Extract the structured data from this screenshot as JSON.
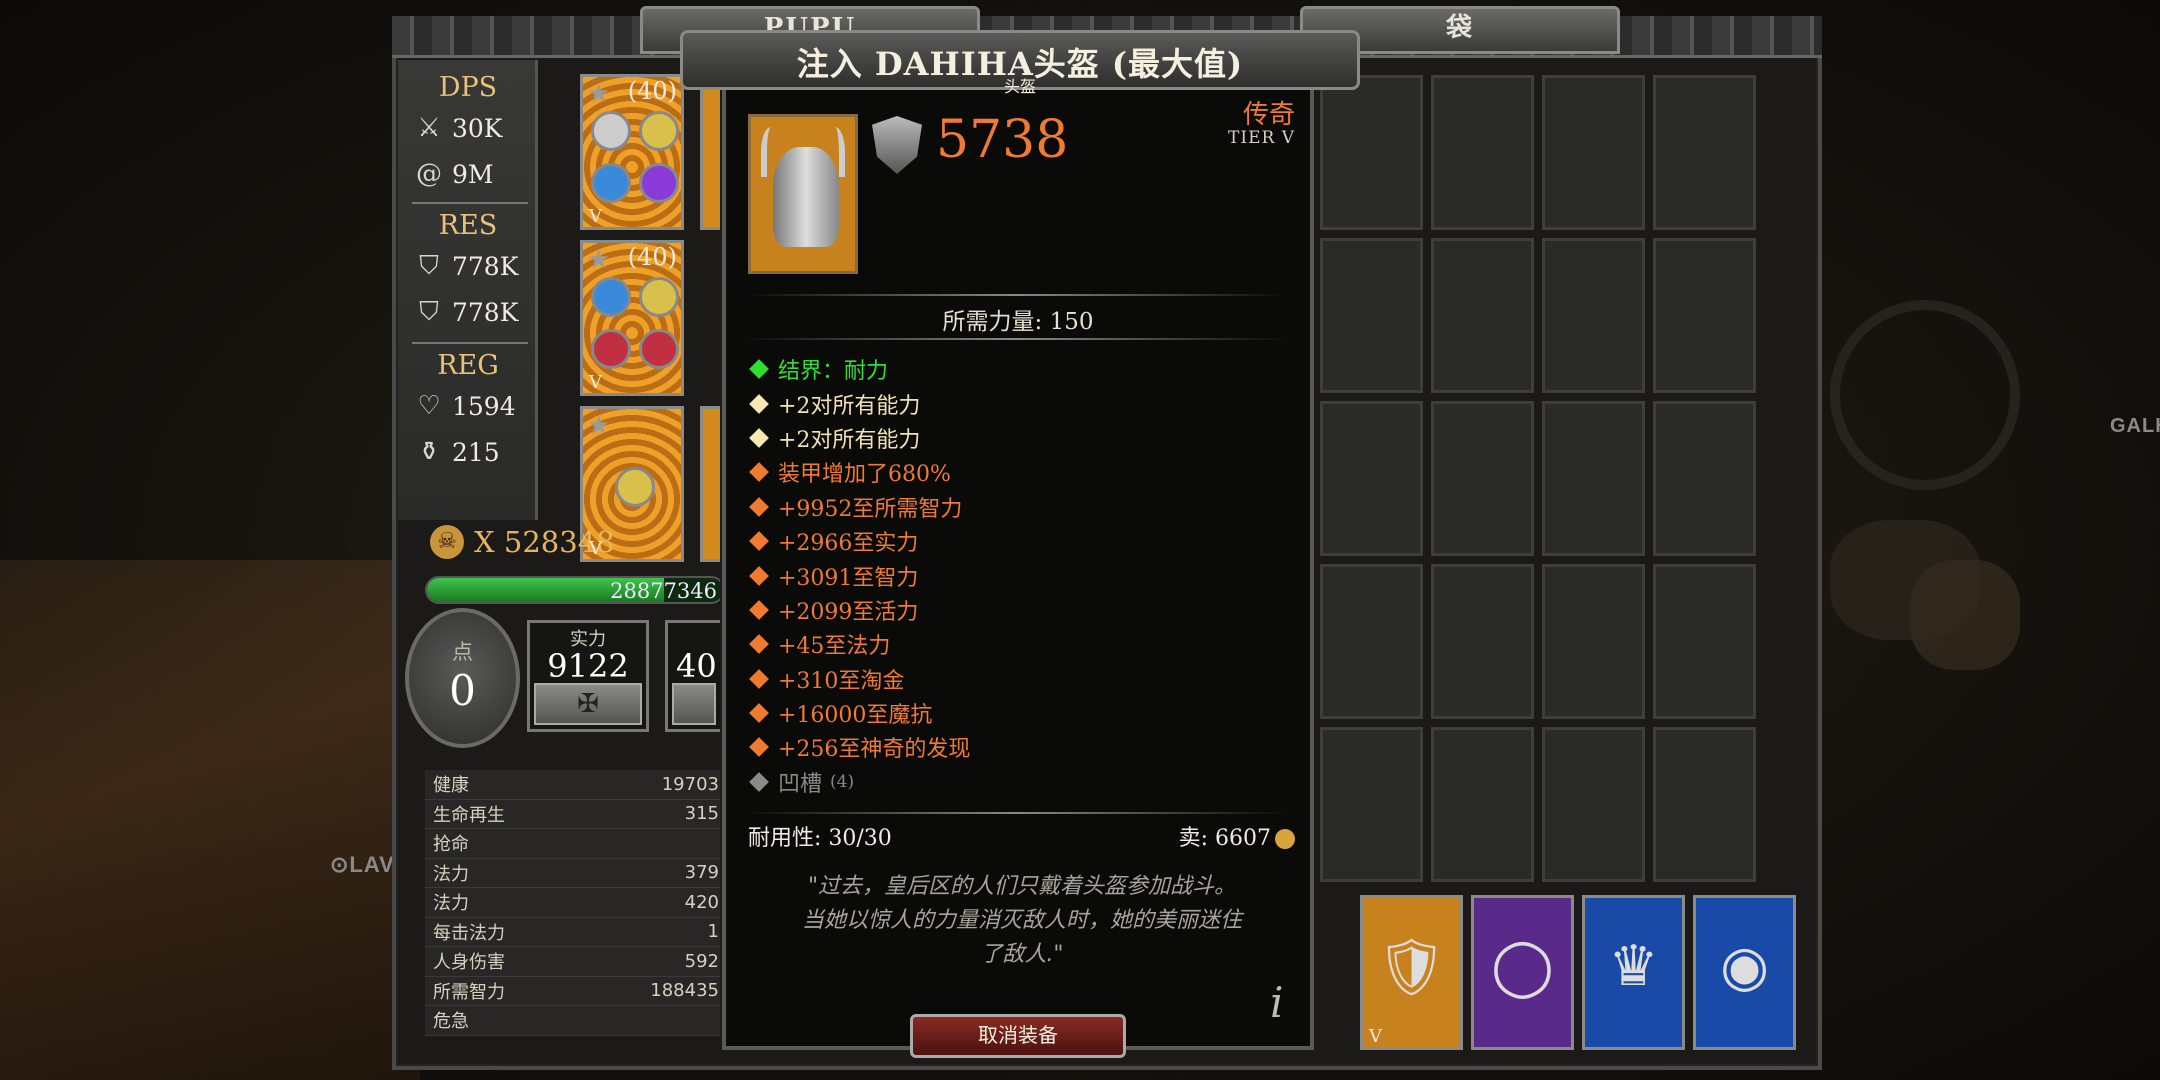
{
  "colors": {
    "legendary": "#f07a30",
    "set_bonus": "#2ee02e",
    "stat_base": "#f7e7b0",
    "socket": "#8a8a86",
    "xp_bar": "#3ec24a"
  },
  "background": {
    "label_galh": "GALH",
    "label_lav": "⊙LAV"
  },
  "tabs": {
    "left": "PUPU",
    "right": "袋"
  },
  "stats_panel": {
    "dps_title": "DPS",
    "dps": [
      {
        "icon": "crossed-swords-icon",
        "value": "30K"
      },
      {
        "icon": "spiral-magic-icon",
        "value": "9M"
      }
    ],
    "res_title": "RES",
    "res": [
      {
        "icon": "shield-sword-icon",
        "value": "778K"
      },
      {
        "icon": "shield-magic-icon",
        "value": "778K"
      }
    ],
    "reg_title": "REG",
    "reg": [
      {
        "icon": "heart-icon",
        "value": "1594"
      },
      {
        "icon": "mana-flask-icon",
        "value": "215"
      }
    ]
  },
  "gem_slots": [
    {
      "count": "(40)",
      "tier": "V"
    },
    {
      "count": "(40)",
      "tier": "V"
    },
    {
      "count": "",
      "tier": "V"
    }
  ],
  "skull": {
    "value": "X 528348"
  },
  "xp": {
    "text": "28877346",
    "fraction": 0.8
  },
  "points": {
    "label": "点",
    "value": "0"
  },
  "attributes": [
    {
      "label": "实力",
      "value": "9122",
      "button": "✠"
    },
    {
      "label": "",
      "value": "40",
      "button": ""
    }
  ],
  "stat_list": [
    {
      "name": "健康",
      "value": "19703"
    },
    {
      "name": "生命再生",
      "value": "315"
    },
    {
      "name": "抢命",
      "value": ""
    },
    {
      "name": "法力",
      "value": "379"
    },
    {
      "name": "法力",
      "value": "420"
    },
    {
      "name": "每击法力",
      "value": "1"
    },
    {
      "name": "人身伤害",
      "value": "592"
    },
    {
      "name": "所需智力",
      "value": "188435"
    },
    {
      "name": "危急",
      "value": ""
    }
  ],
  "tooltip": {
    "title": "注入 DAHIHA头盔 (最大值)",
    "subtitle": "头盔",
    "armor_value": "5738",
    "rarity": "传奇",
    "tier": "TIER V",
    "requirement": "所需力量: 150",
    "affixes": [
      {
        "type": "green",
        "text": "结界：耐力"
      },
      {
        "type": "yellow",
        "text": "+2对所有能力"
      },
      {
        "type": "yellow",
        "text": "+2对所有能力"
      },
      {
        "type": "orange",
        "text": "装甲增加了680%"
      },
      {
        "type": "orange",
        "text": "+9952至所需智力"
      },
      {
        "type": "orange",
        "text": "+2966至实力"
      },
      {
        "type": "orange",
        "text": "+3091至智力"
      },
      {
        "type": "orange",
        "text": "+2099至活力"
      },
      {
        "type": "orange",
        "text": "+45至法力"
      },
      {
        "type": "orange",
        "text": "+310至淘金"
      },
      {
        "type": "orange",
        "text": "+16000至魔抗"
      },
      {
        "type": "orange",
        "text": "+256至神奇的发现"
      },
      {
        "type": "grey",
        "text": "凹槽",
        "extra": "(4)"
      }
    ],
    "durability": "耐用性: 30/30",
    "sell": "卖: 6607",
    "flavor": [
      "\"过去，皇后区的人们只戴着头盔参加战斗。",
      "当她以惊人的力量消灭敌人时，她的美丽迷住",
      "了敌人.\""
    ],
    "info": "i",
    "unequip": "取消装备"
  },
  "equipment": [
    {
      "name": "chest-armor",
      "tier": "V",
      "color": "#c8821d"
    },
    {
      "name": "mirror",
      "tier": "",
      "color": "#5a2a8a"
    },
    {
      "name": "crown-gem",
      "tier": "",
      "color": "#1a4aa8"
    },
    {
      "name": "ring",
      "tier": "",
      "color": "#1a4aa8"
    }
  ]
}
